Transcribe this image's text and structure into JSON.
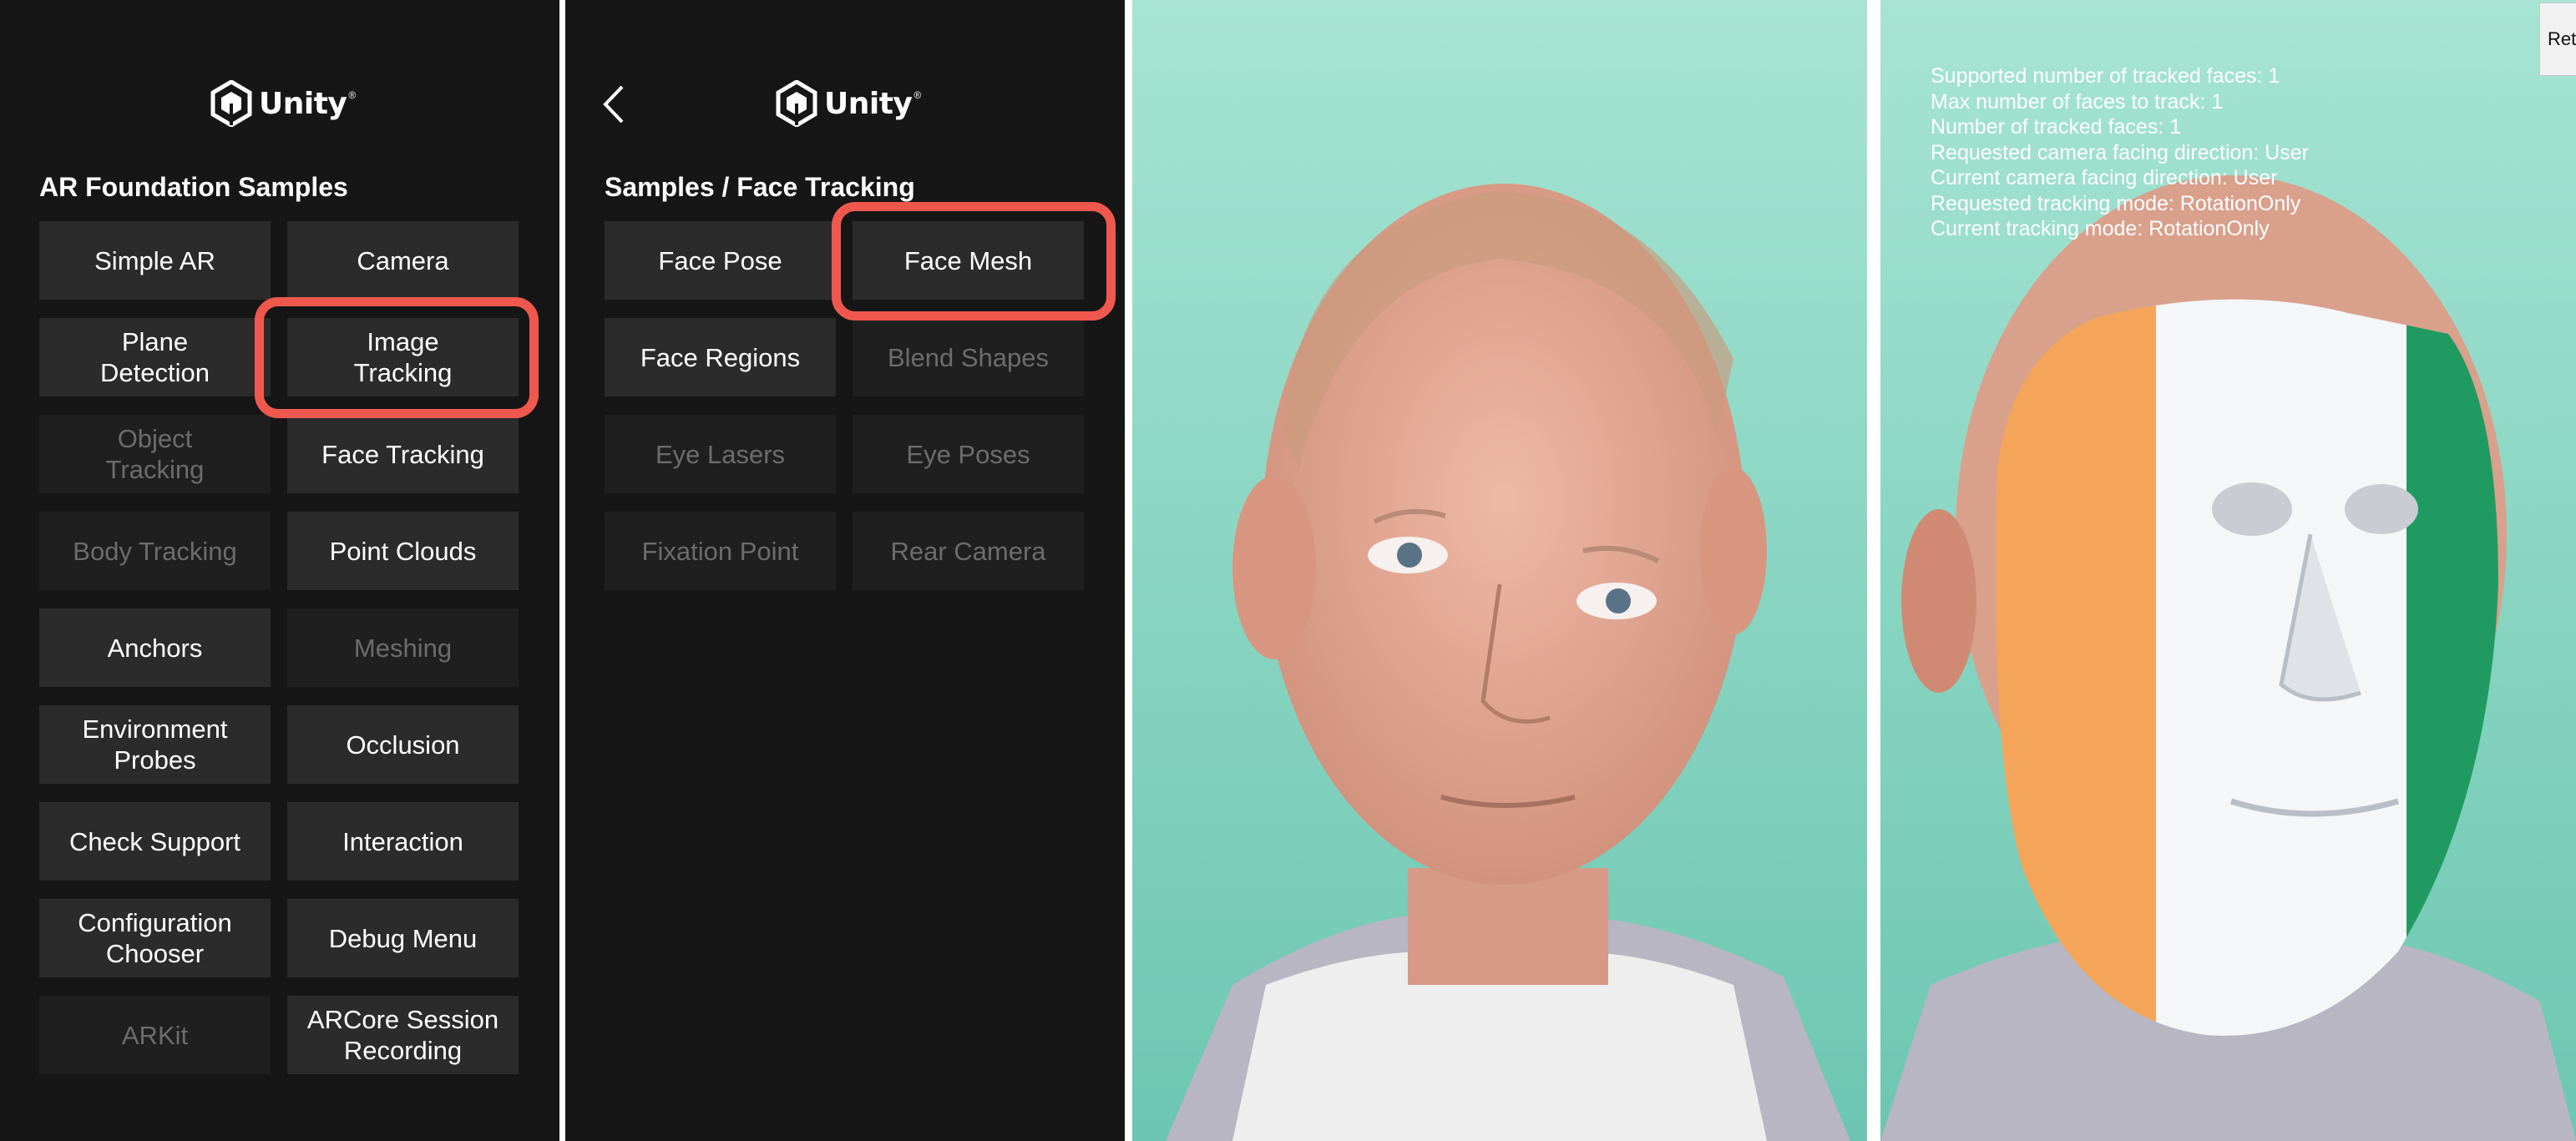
{
  "colors": {
    "highlight": "#f0584e",
    "menu_bg": "#161616",
    "button_bg": "#2b2b2b",
    "disabled_text": "#6c6c6c"
  },
  "brand": {
    "name": "Unity",
    "reg": "®"
  },
  "main_menu": {
    "title": "AR Foundation Samples",
    "buttons": [
      {
        "label": "Simple AR"
      },
      {
        "label": "Camera"
      },
      {
        "label": "Plane\nDetection"
      },
      {
        "label": "Image\nTracking",
        "highlighted": true
      },
      {
        "label": "Object\nTracking",
        "disabled": true
      },
      {
        "label": "Face Tracking"
      },
      {
        "label": "Body Tracking",
        "disabled": true
      },
      {
        "label": "Point Clouds"
      },
      {
        "label": "Anchors"
      },
      {
        "label": "Meshing",
        "disabled": true
      },
      {
        "label": "Environment\nProbes"
      },
      {
        "label": "Occlusion"
      },
      {
        "label": "Check Support"
      },
      {
        "label": "Interaction"
      },
      {
        "label": "Configuration\nChooser"
      },
      {
        "label": "Debug Menu"
      },
      {
        "label": "ARKit",
        "disabled": true
      },
      {
        "label": "ARCore Session\nRecording"
      }
    ]
  },
  "face_menu": {
    "back_icon": "chevron-left-icon",
    "title": "Samples / Face Tracking",
    "buttons": [
      {
        "label": "Face Pose"
      },
      {
        "label": "Face Mesh",
        "highlighted": true
      },
      {
        "label": "Face Regions"
      },
      {
        "label": "Blend Shapes",
        "disabled": true
      },
      {
        "label": "Eye Lasers",
        "disabled": true
      },
      {
        "label": "Eye Poses",
        "disabled": true
      },
      {
        "label": "Fixation Point",
        "disabled": true
      },
      {
        "label": "Rear Camera",
        "disabled": true
      }
    ]
  },
  "tracking_view": {
    "status_lines": [
      "Supported number of tracked faces: 1",
      "Max number of faces to track: 1",
      "Number of tracked faces: 1",
      "Requested camera facing direction: User",
      "Current camera facing direction: User",
      "Requested tracking mode: RotationOnly",
      "Current tracking mode: RotationOnly"
    ],
    "return_label": "Return",
    "mesh_colors": [
      "#f5a55a",
      "#ffffff",
      "#1f9b62"
    ]
  }
}
